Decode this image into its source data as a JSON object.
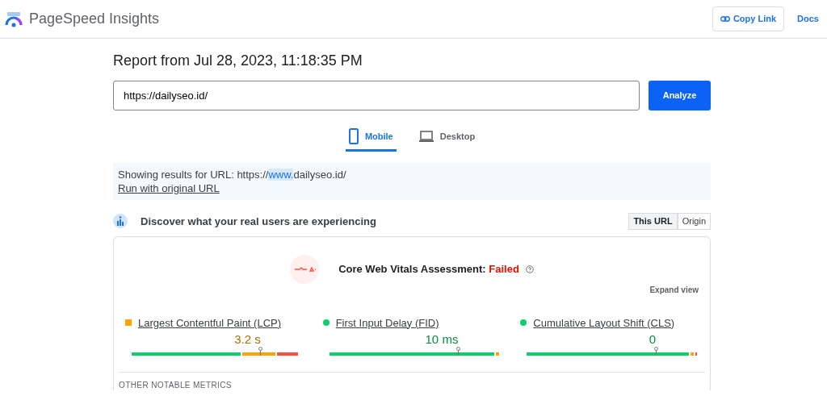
{
  "header": {
    "title": "PageSpeed Insights",
    "copy_link": "Copy Link",
    "docs": "Docs"
  },
  "report_title": "Report from Jul 28, 2023, 11:18:35 PM",
  "url_field": {
    "value": "https://dailyseo.id/"
  },
  "analyze_button": "Analyze",
  "tabs": [
    {
      "label": "Mobile",
      "kind": "mobile",
      "selected": true
    },
    {
      "label": "Desktop",
      "kind": "desktop",
      "selected": false
    }
  ],
  "notice": {
    "prefix": "Showing results for URL: https://",
    "highlight": "www.",
    "suffix": "dailyseo.id/",
    "link": "Run with original URL"
  },
  "field_data": {
    "heading": "Discover what your real users are experiencing",
    "toggle": [
      {
        "label": "This URL",
        "selected": true
      },
      {
        "label": "Origin",
        "selected": false
      }
    ],
    "assessment_label": "Core Web Vitals Assessment:",
    "assessment_result": "Failed",
    "passed": false,
    "expand": "Expand view",
    "metrics": [
      {
        "name": "Largest Contentful Paint (LCP)",
        "kind": "square",
        "color": "#ffa400",
        "value": "3.2 s",
        "segments": [
          {
            "color": "#0cce6b"
          },
          {
            "color": "#ffa400"
          },
          {
            "color": "#ff4e42"
          }
        ]
      },
      {
        "name": "First Input Delay (FID)",
        "kind": "dot",
        "color": "#0cce6b",
        "value": "10 ms",
        "segments": [
          {
            "color": "#0cce6b"
          },
          {
            "color": "#ffa400"
          }
        ]
      },
      {
        "name": "Cumulative Layout Shift (CLS)",
        "kind": "dot",
        "color": "#0cce6b",
        "value": "0",
        "segments": [
          {
            "color": "#0cce6b"
          },
          {
            "color": "#ffa400"
          },
          {
            "color": "#ff4e42"
          }
        ]
      }
    ],
    "other_heading": "OTHER NOTABLE METRICS"
  }
}
